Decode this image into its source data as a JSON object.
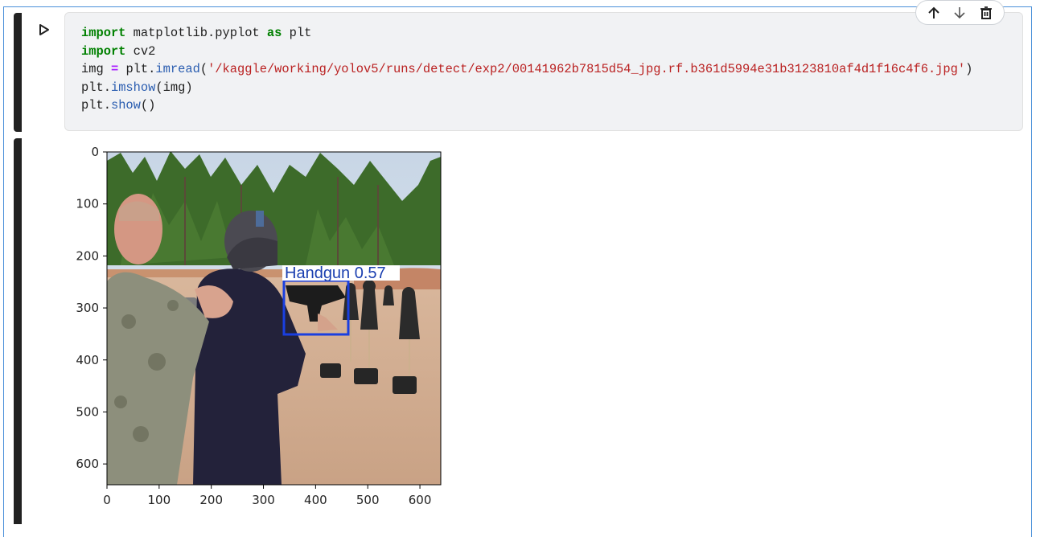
{
  "notebook": {
    "code_lines": [
      [
        {
          "t": "import",
          "c": "kw"
        },
        {
          "t": " matplotlib.pyplot ",
          "c": ""
        },
        {
          "t": "as",
          "c": "kw"
        },
        {
          "t": " plt",
          "c": ""
        }
      ],
      [
        {
          "t": "import",
          "c": "kw"
        },
        {
          "t": " cv2",
          "c": ""
        }
      ],
      [
        {
          "t": "img ",
          "c": ""
        },
        {
          "t": "=",
          "c": "op"
        },
        {
          "t": " plt.",
          "c": ""
        },
        {
          "t": "imread",
          "c": "fn"
        },
        {
          "t": "(",
          "c": ""
        },
        {
          "t": "'/kaggle/working/yolov5/runs/detect/exp2/00141962b7815d54_jpg.rf.b361d5994e31b3123810af4d1f16c4f6.jpg'",
          "c": "str"
        },
        {
          "t": ")",
          "c": ""
        }
      ],
      [
        {
          "t": "plt.",
          "c": ""
        },
        {
          "t": "imshow",
          "c": "fn"
        },
        {
          "t": "(img)",
          "c": ""
        }
      ],
      [
        {
          "t": "plt.",
          "c": ""
        },
        {
          "t": "show",
          "c": "fn"
        },
        {
          "t": "()",
          "c": ""
        }
      ]
    ],
    "toolbar": {
      "move_up_icon": "arrow-up-icon",
      "move_down_icon": "arrow-down-icon",
      "delete_icon": "trash-icon"
    }
  },
  "output": {
    "plot": {
      "x_ticks": [
        "0",
        "100",
        "200",
        "300",
        "400",
        "500",
        "600"
      ],
      "y_ticks": [
        "0",
        "100",
        "200",
        "300",
        "400",
        "500",
        "600"
      ],
      "detection_label": "Handgun 0.57",
      "box_color": "#1a3fe0"
    }
  }
}
